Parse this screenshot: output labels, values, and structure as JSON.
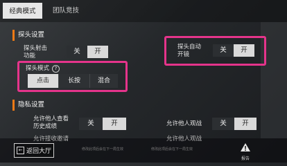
{
  "tabs": {
    "classic": "经典模式",
    "team": "团队竞技"
  },
  "peek_section": {
    "title": "探头设置",
    "peek_fire": {
      "label_line1": "探头射击",
      "label_line2": "功能",
      "off": "关",
      "on": "开"
    },
    "auto_peek": {
      "label_line1": "探头自动",
      "label_line2": "开镜",
      "off": "关",
      "on": "开"
    },
    "peek_mode": {
      "label": "探头模式",
      "help": "?",
      "options": [
        "点击",
        "长按",
        "混合"
      ]
    }
  },
  "privacy_section": {
    "title": "隐私设置",
    "allow_view_history": {
      "label_line1": "允许他人查看",
      "label_line2": "历史成绩",
      "off": "关",
      "on": "开"
    },
    "allow_spectate": {
      "label": "允许他人观战",
      "off": "关",
      "on": "开"
    },
    "allow_cut_1": "允许接收邀请",
    "allow_cut_2": "允许他人观战"
  },
  "bottom": {
    "back": "返回大厅",
    "hint_1": "修改此项后会在下一局生效",
    "hint_2": "修改此项后会在下一局生效",
    "report": "报告"
  },
  "colors": {
    "highlight": "#e5348b",
    "accent": "#f07a16"
  }
}
